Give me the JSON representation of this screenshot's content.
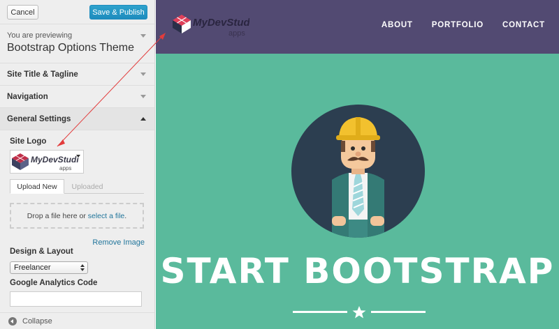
{
  "customizer": {
    "cancel_label": "Cancel",
    "publish_label": "Save & Publish",
    "previewing_label": "You are previewing",
    "theme_name": "Bootstrap Options Theme",
    "sections": [
      {
        "label": "Site Title & Tagline",
        "expanded": false
      },
      {
        "label": "Navigation",
        "expanded": false
      },
      {
        "label": "General Settings",
        "expanded": true
      }
    ],
    "site_logo": {
      "label": "Site Logo",
      "tabs": [
        "Upload New",
        "Uploaded"
      ],
      "active_tab": "Upload New",
      "drop_text": "Drop a file here or ",
      "drop_link": "select a file",
      "drop_suffix": ".",
      "remove_label": "Remove Image"
    },
    "design_layout": {
      "label": "Design & Layout",
      "selected": "Freelancer"
    },
    "google_analytics": {
      "label": "Google Analytics Code",
      "value": ""
    },
    "collapse_label": "Collapse"
  },
  "site": {
    "logo_text": "MyDevStudio",
    "logo_sub": "apps",
    "nav": [
      "ABOUT",
      "PORTFOLIO",
      "CONTACT"
    ],
    "hero_title": "START BOOTSTRAP"
  },
  "colors": {
    "navbar": "#524a72",
    "hero_bg": "#5aba9c",
    "avatar_bg": "#2c3e50",
    "accent_link": "#21759b",
    "publish_btn": "#2ea2cc",
    "annotation_arrow": "#e23c3c"
  }
}
